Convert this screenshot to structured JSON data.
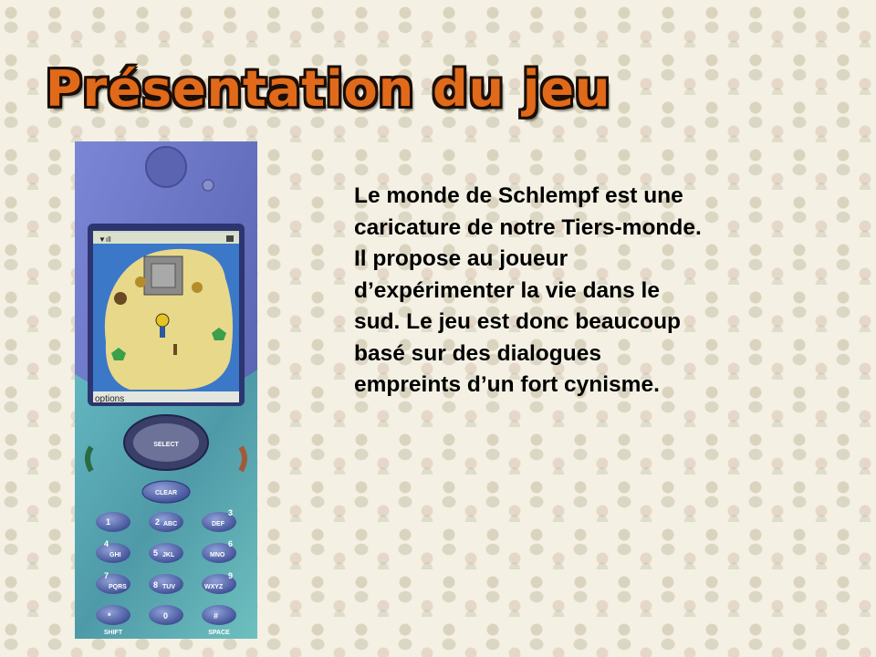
{
  "slide": {
    "title": "Présentation du jeu",
    "paragraph_lines": [
      "Le monde de Schlempf est une",
      "caricature de notre Tiers-monde.",
      "Il propose au joueur",
      "d’expérimenter la vie dans le",
      "sud. Le jeu est donc beaucoup",
      "basé sur des dialogues",
      "empreints d’un fort cynisme."
    ]
  },
  "phone": {
    "softkey_label": "options",
    "select_label": "SELECT",
    "clear_label": "CLEAR",
    "keys": [
      {
        "digit": "1",
        "letters": ""
      },
      {
        "digit": "2",
        "letters": "ABC"
      },
      {
        "digit": "3",
        "letters": "DEF"
      },
      {
        "digit": "4",
        "letters": "GHI"
      },
      {
        "digit": "5",
        "letters": "JKL"
      },
      {
        "digit": "6",
        "letters": "MNO"
      },
      {
        "digit": "7",
        "letters": "PQRS"
      },
      {
        "digit": "8",
        "letters": "TUV"
      },
      {
        "digit": "9",
        "letters": "WXYZ"
      },
      {
        "digit": "*",
        "letters": ""
      },
      {
        "digit": "0",
        "letters": ""
      },
      {
        "digit": "#",
        "letters": ""
      }
    ],
    "shift_label": "SHIFT",
    "space_label": "SPACE"
  },
  "colors": {
    "title_fill": "#e06a1a",
    "title_outline": "#1a0e05",
    "phone_body": "#6a78c2",
    "keypad_body": "#5aa6b0",
    "screen_water": "#3b78c8",
    "screen_sand": "#e8d88a"
  }
}
